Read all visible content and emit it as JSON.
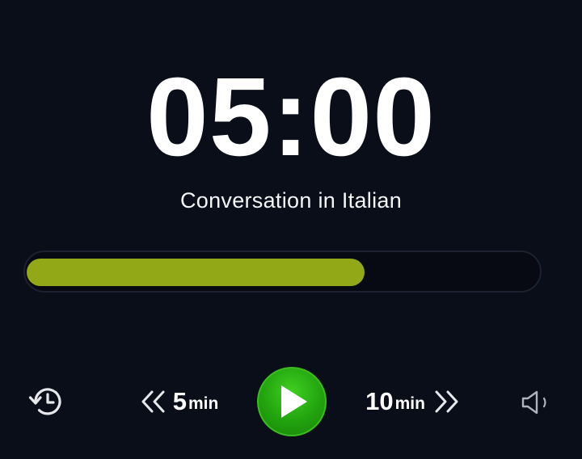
{
  "timer": {
    "display": "05:00"
  },
  "session": {
    "label": "Conversation in Italian"
  },
  "progress": {
    "fraction": 0.66,
    "color": "#93a817"
  },
  "controls": {
    "rewind": {
      "value": "5",
      "unit": "min",
      "icon": "double-chevron-left-icon"
    },
    "forward": {
      "value": "10",
      "unit": "min",
      "icon": "double-chevron-right-icon"
    },
    "history_icon": "history-icon",
    "play_icon": "play-icon",
    "volume_icon": "volume-icon",
    "play_color": "#22a30e"
  }
}
